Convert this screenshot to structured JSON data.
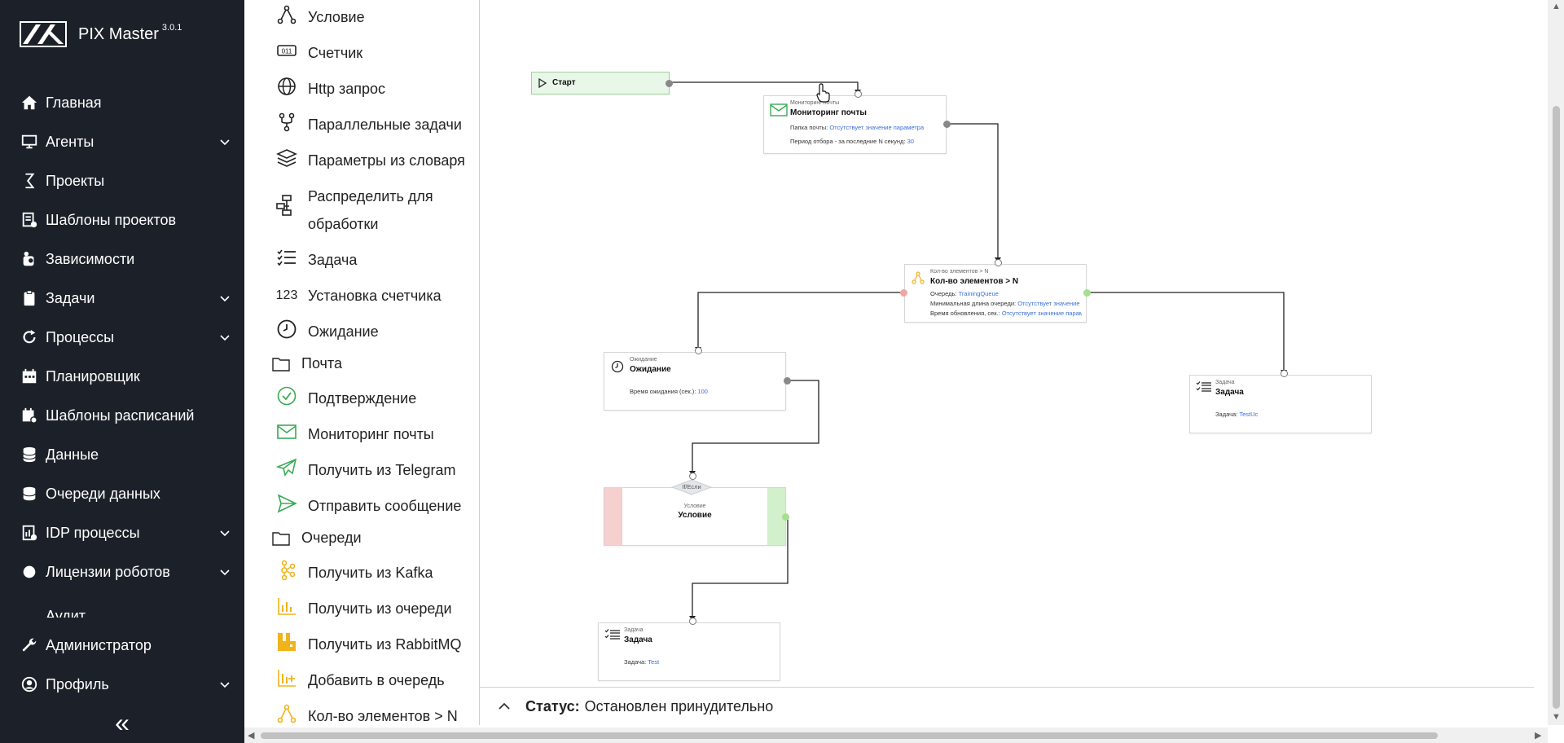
{
  "app": {
    "name": "PIX Master",
    "version": "3.0.1"
  },
  "sidebar": {
    "items": [
      {
        "label": "Главная",
        "icon": "home-icon"
      },
      {
        "label": "Агенты",
        "icon": "monitor-icon",
        "expandable": true
      },
      {
        "label": "Проекты",
        "icon": "projects-icon"
      },
      {
        "label": "Шаблоны проектов",
        "icon": "template-icon"
      },
      {
        "label": "Зависимости",
        "icon": "dependencies-icon"
      },
      {
        "label": "Задачи",
        "icon": "clipboard-icon",
        "expandable": true
      },
      {
        "label": "Процессы",
        "icon": "refresh-icon",
        "expandable": true
      },
      {
        "label": "Планировщик",
        "icon": "calendar-icon"
      },
      {
        "label": "Шаблоны расписаний",
        "icon": "calendar-gear-icon"
      },
      {
        "label": "Данные",
        "icon": "database-icon"
      },
      {
        "label": "Очереди данных",
        "icon": "queue-db-icon"
      },
      {
        "label": "IDP процессы",
        "icon": "idp-icon",
        "expandable": true
      },
      {
        "label": "Лицензии роботов",
        "icon": "license-icon",
        "expandable": true
      },
      {
        "label": "Аудит",
        "icon": "audit-icon"
      },
      {
        "label": "Администратор",
        "icon": "wrench-icon"
      },
      {
        "label": "Профиль",
        "icon": "user-icon",
        "expandable": true
      }
    ],
    "collapse_label": "«"
  },
  "palette": {
    "items": [
      {
        "label": "Условие",
        "icon": "condition-icon"
      },
      {
        "label": "Счетчик",
        "icon": "counter-icon"
      },
      {
        "label": "Http запрос",
        "icon": "globe-icon"
      },
      {
        "label": "Параллельные задачи",
        "icon": "parallel-icon"
      },
      {
        "label": "Параметры из словаря",
        "icon": "layers-icon"
      },
      {
        "label": "Распределить для обработки",
        "icon": "distribute-icon"
      },
      {
        "label": "Задача",
        "icon": "task-list-icon"
      },
      {
        "label": "Установка счетчика",
        "icon": "set-counter-icon"
      },
      {
        "label": "Ожидание",
        "icon": "clock-icon"
      }
    ],
    "folders": [
      {
        "label": "Почта",
        "icon": "folder-icon"
      },
      {
        "label": "Очереди",
        "icon": "folder-icon"
      }
    ],
    "mail_items": [
      {
        "label": "Подтверждение",
        "icon": "check-circle-icon"
      },
      {
        "label": "Мониторинг почты",
        "icon": "mail-icon"
      },
      {
        "label": "Получить из Telegram",
        "icon": "telegram-icon"
      },
      {
        "label": "Отправить сообщение",
        "icon": "send-icon"
      }
    ],
    "queue_items": [
      {
        "label": "Получить из Kafka",
        "icon": "kafka-icon"
      },
      {
        "label": "Получить из очереди",
        "icon": "queue-chart-icon"
      },
      {
        "label": "Получить из RabbitMQ",
        "icon": "rabbitmq-icon"
      },
      {
        "label": "Добавить в очередь",
        "icon": "queue-add-icon"
      },
      {
        "label": "Кол-во элементов > N",
        "icon": "count-n-icon"
      }
    ]
  },
  "canvas": {
    "start": {
      "label": "Старт"
    },
    "mail_monitor": {
      "small": "Мониторинг почты",
      "title": "Мониторинг почты",
      "folder_label": "Папка почты:",
      "folder_value": "Отсутствует значение параметра",
      "period_label": "Период отбора - за последние N секунд:",
      "period_value": "30"
    },
    "count_n": {
      "small": "Кол-во элементов > N",
      "title": "Кол-во элементов > N",
      "queue_label": "Очередь:",
      "queue_value": "TrainingQueue",
      "minlen_label": "Минимальная длина очереди:",
      "minlen_value": "Отсутствует значение п...",
      "update_label": "Время обновления, сек.:",
      "update_value": "Отсутствует значение параме..."
    },
    "wait": {
      "small": "Ожидание",
      "title": "Ожидание",
      "time_label": "Время ожидания (сек.):",
      "time_value": "100"
    },
    "task_right": {
      "small": "Задача",
      "title": "Задача",
      "task_label": "Задача:",
      "task_value": "TestUc"
    },
    "condition": {
      "tag": "If/Если",
      "small": "Условие",
      "title": "Условие"
    },
    "task_bottom": {
      "small": "Задача",
      "title": "Задача",
      "task_label": "Задача:",
      "task_value": "Test"
    }
  },
  "status": {
    "label": "Статус:",
    "value": "Остановлен принудительно"
  }
}
